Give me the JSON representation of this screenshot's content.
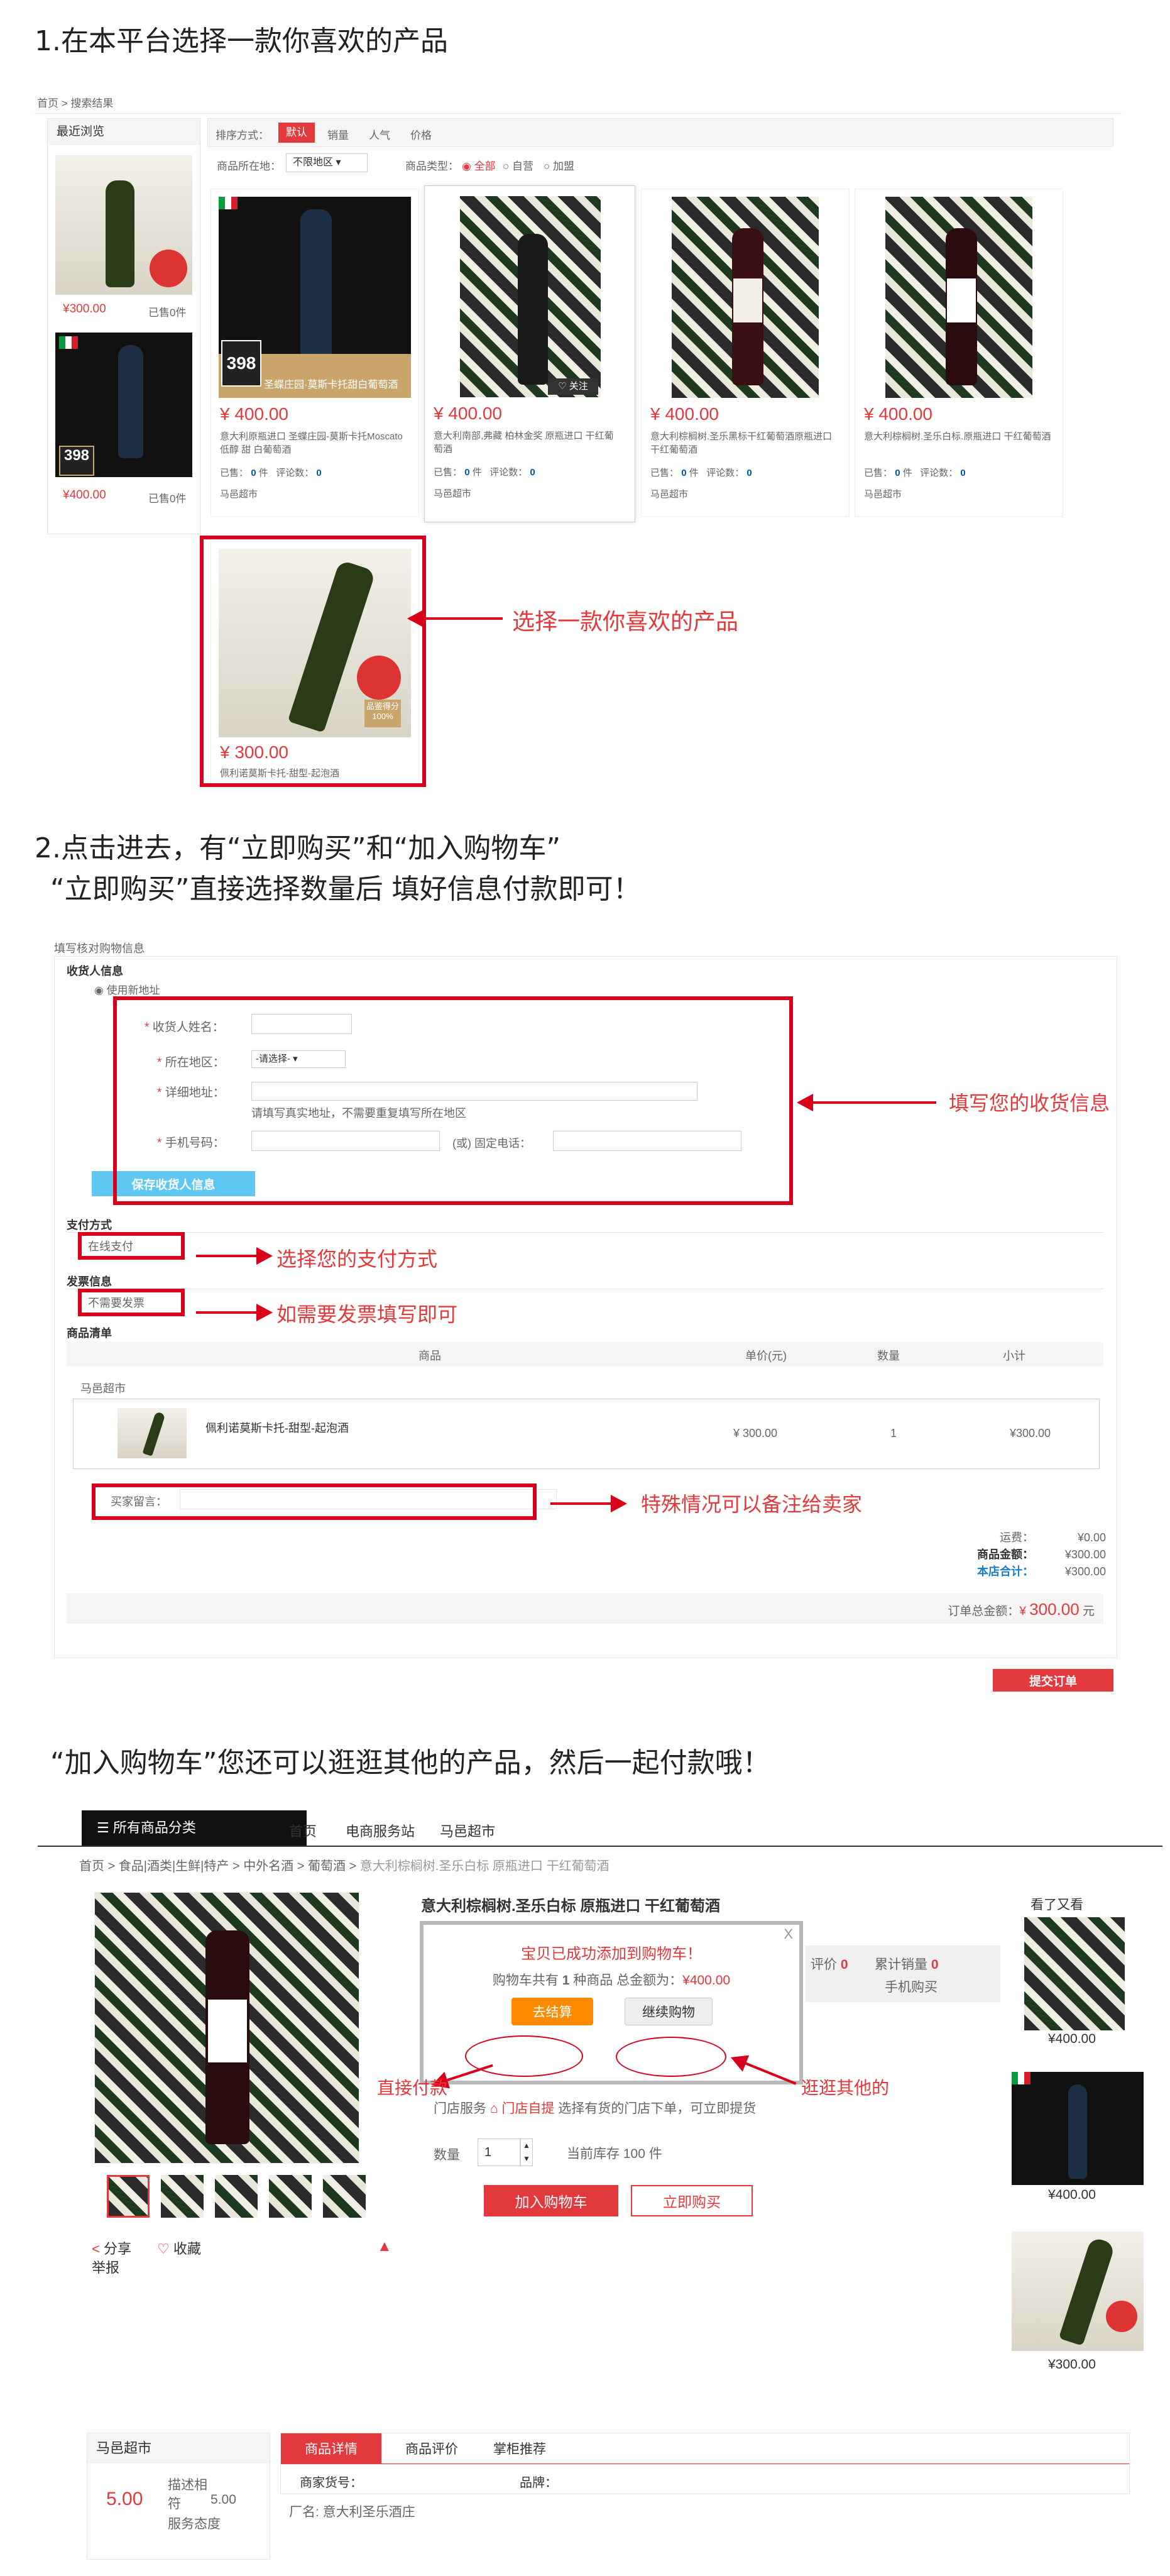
{
  "section1": {
    "title": "1.在本平台选择一款你喜欢的产品",
    "breadcrumb": {
      "home": "首页",
      "sep": ">",
      "current": "搜索结果"
    },
    "recent": {
      "title": "最近浏览",
      "items": [
        {
          "price": "¥300.00",
          "sold": "已售0件"
        },
        {
          "badge": "398",
          "price": "¥400.00",
          "sold": "已售0件"
        }
      ]
    },
    "sortbar": {
      "label": "排序方式：",
      "options": [
        "默认",
        "销量",
        "人气",
        "价格"
      ],
      "active": "默认"
    },
    "filters": {
      "location_label": "商品所在地：",
      "location_value": "不限地区",
      "type_label": "商品类型：",
      "types": [
        "全部",
        "自营",
        "加盟"
      ],
      "selected_type": "全部"
    },
    "products": [
      {
        "price": "¥ 400.00",
        "name": "意大利原瓶进口 圣蝶庄园-莫斯卡托Moscato 低醇 甜 白葡萄酒",
        "banner": "圣蝶庄园·莫斯卡托甜白葡萄酒",
        "badge": "398",
        "sold_label": "已售：",
        "sold": "0",
        "sold_unit": "件",
        "reviews_label": "评论数：",
        "reviews": "0",
        "shop": "马邑超市"
      },
      {
        "price": "¥ 400.00",
        "name": "意大利南部,弗藏 柏林金奖 原瓶进口 干红葡萄酒",
        "follow": "关注",
        "sold_label": "已售：",
        "sold": "0",
        "sold_unit": "件",
        "reviews_label": "评论数：",
        "reviews": "0",
        "shop": "马邑超市"
      },
      {
        "price": "¥ 400.00",
        "name": "意大利棕榈树.圣乐黑标干红葡萄酒原瓶进口干红葡萄酒",
        "sold_label": "已售：",
        "sold": "0",
        "sold_unit": "件",
        "reviews_label": "评论数：",
        "reviews": "0",
        "shop": "马邑超市"
      },
      {
        "price": "¥ 400.00",
        "name": "意大利棕榈树.圣乐白标.原瓶进口 干红葡萄酒",
        "sold_label": "已售：",
        "sold": "0",
        "sold_unit": "件",
        "reviews_label": "评论数：",
        "reviews": "0",
        "shop": "马邑超市"
      },
      {
        "price": "¥ 300.00",
        "name": "佩利诺莫斯卡托-甜型-起泡酒",
        "badge_text": "品鉴得分100%"
      }
    ],
    "callout": "选择一款你喜欢的产品"
  },
  "section2": {
    "title_line1": "2.点击进去，有“立即购买”和“加入购物车”",
    "title_line2": "“立即购买”直接选择数量后 填好信息付款即可！",
    "page_title": "填写核对购物信息",
    "receiver_title": "收货人信息",
    "new_address": "使用新地址",
    "fields": {
      "name_label": "收货人姓名：",
      "region_label": "所在地区：",
      "region_select": "-请选择-",
      "address_label": "详细地址：",
      "address_hint": "请填写真实地址，不需要重复填写所在地区",
      "phone_label": "手机号码：",
      "tel_label": "(或) 固定电话："
    },
    "save_button": "保存收货人信息",
    "payment_title": "支付方式",
    "payment_value": "在线支付",
    "invoice_title": "发票信息",
    "invoice_value": "不需要发票",
    "goods_title": "商品清单",
    "table_headers": [
      "商品",
      "单价(元)",
      "数量",
      "小计"
    ],
    "shop_name": "马邑超市",
    "item": {
      "name": "佩利诺莫斯卡托-甜型-起泡酒",
      "price": "¥ 300.00",
      "qty": "1",
      "subtotal": "¥300.00"
    },
    "message_label": "买家留言：",
    "summary": {
      "shipping_label": "运费：",
      "shipping": "¥0.00",
      "goods_label": "商品金额：",
      "goods": "¥300.00",
      "shop_total_label": "本店合计：",
      "shop_total": "¥300.00",
      "order_total_label": "订单总金额：",
      "currency": "¥",
      "order_total": "300.00",
      "unit": "元"
    },
    "submit_button": "提交订单",
    "callouts": {
      "address": "填写您的收货信息",
      "payment": "选择您的支付方式",
      "invoice": "如需要发票填写即可",
      "message": "特殊情况可以备注给卖家"
    }
  },
  "section3": {
    "title": "“加入购物车”您还可以逛逛其他的产品，然后一起付款哦！",
    "nav": {
      "all_categories": "所有商品分类",
      "links": [
        "首页",
        "电商服务站",
        "马邑超市"
      ]
    },
    "breadcrumb": [
      "首页",
      "食品|酒类|生鲜|特产",
      "中外名酒",
      "葡萄酒",
      "意大利棕榈树.圣乐白标 原瓶进口 干红葡萄酒"
    ],
    "product_title": "意大利棕榈树.圣乐白标 原瓶进口 干红葡萄酒",
    "popup": {
      "close": "X",
      "message": "宝贝已成功添加到购物车！",
      "summary_pre": "购物车共有",
      "summary_count": "1",
      "summary_mid": "种商品 总金额为：",
      "summary_amount": "¥400.00",
      "checkout": "去结算",
      "continue": "继续购物"
    },
    "side_stats": {
      "review_label": "评价",
      "review_count": "0",
      "sales_label": "累计销量",
      "sales_count": "0",
      "mobile": "手机购买"
    },
    "store_service": {
      "label": "门店服务",
      "link": "门店自提",
      "text": "选择有货的门店下单，可立即提货"
    },
    "quantity": {
      "label": "数量",
      "value": "1",
      "stock": "当前库存 100 件"
    },
    "buttons": {
      "add_cart": "加入购物车",
      "buy_now": "立即购买"
    },
    "share": "分享",
    "favorite": "收藏",
    "report": "举报",
    "see_also": {
      "title": "看了又看",
      "prices": [
        "¥400.00",
        "¥400.00",
        "¥300.00"
      ]
    },
    "shop_card": {
      "name": "马邑超市",
      "score": "5.00",
      "desc_label": "描述相符",
      "desc_score": "5.00",
      "service_label": "服务态度"
    },
    "tabs": [
      "商品详情",
      "商品评价",
      "掌柜推荐"
    ],
    "detail": {
      "sku_label": "商家货号：",
      "brand_label": "品牌：",
      "maker": "厂名: 意大利圣乐酒庄"
    },
    "callouts": {
      "direct_pay": "直接付款",
      "browse": "逛逛其他的"
    }
  },
  "colors": {
    "accent": "#e4393c",
    "annotation": "#d9001b",
    "orange": "#ff8a00",
    "blue": "#5ec8f2"
  }
}
